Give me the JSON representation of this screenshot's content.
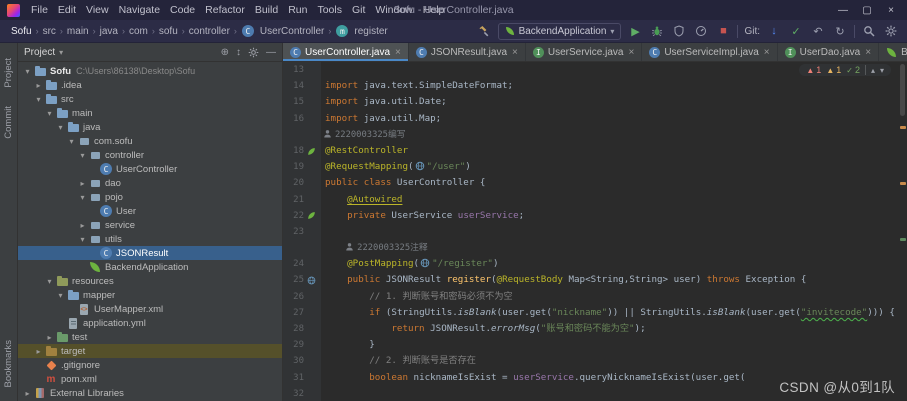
{
  "titlebar": {
    "title": "Sofu - UserController.java",
    "menus": [
      "File",
      "Edit",
      "View",
      "Navigate",
      "Code",
      "Refactor",
      "Build",
      "Run",
      "Tools",
      "Git",
      "Window",
      "Help"
    ],
    "controls": {
      "minimize": "—",
      "maximize": "▢",
      "close": "×"
    }
  },
  "toolbar": {
    "breadcrumbs": [
      {
        "label": "Sofu"
      },
      {
        "label": "src"
      },
      {
        "label": "main"
      },
      {
        "label": "java"
      },
      {
        "label": "com"
      },
      {
        "label": "sofu"
      },
      {
        "label": "controller"
      },
      {
        "label": "UserController",
        "icon": "class"
      },
      {
        "label": "register",
        "icon": "method"
      }
    ],
    "run_config": "BackendApplication",
    "git_label": "Git:"
  },
  "stripe": {
    "top": [
      "Project",
      "Commit"
    ],
    "bottom": [
      "Bookmarks"
    ]
  },
  "project": {
    "header": "Project",
    "tree": [
      {
        "label": "Sofu",
        "sublabel": "C:\\Users\\86138\\Desktop\\Sofu",
        "level": 0,
        "icon": "folder",
        "chevron": "expanded",
        "bold": true
      },
      {
        "label": ".idea",
        "level": 1,
        "icon": "folder",
        "chevron": "collapsed"
      },
      {
        "label": "src",
        "level": 1,
        "icon": "folder",
        "chevron": "expanded"
      },
      {
        "label": "main",
        "level": 2,
        "icon": "folder",
        "chevron": "expanded"
      },
      {
        "label": "java",
        "level": 3,
        "icon": "folder",
        "chevron": "expanded"
      },
      {
        "label": "com.sofu",
        "level": 4,
        "icon": "package",
        "chevron": "expanded"
      },
      {
        "label": "controller",
        "level": 5,
        "icon": "package",
        "chevron": "expanded"
      },
      {
        "label": "UserController",
        "level": 6,
        "icon": "class"
      },
      {
        "label": "dao",
        "level": 5,
        "icon": "package",
        "chevron": "collapsed"
      },
      {
        "label": "pojo",
        "level": 5,
        "icon": "package",
        "chevron": "expanded"
      },
      {
        "label": "User",
        "level": 6,
        "icon": "class"
      },
      {
        "label": "service",
        "level": 5,
        "icon": "package",
        "chevron": "collapsed"
      },
      {
        "label": "utils",
        "level": 5,
        "icon": "package",
        "chevron": "expanded"
      },
      {
        "label": "JSONResult",
        "level": 6,
        "icon": "class",
        "selected": true
      },
      {
        "label": "BackendApplication",
        "level": 5,
        "icon": "spring"
      },
      {
        "label": "resources",
        "level": 2,
        "icon": "folder-res",
        "chevron": "expanded"
      },
      {
        "label": "mapper",
        "level": 3,
        "icon": "folder",
        "chevron": "expanded"
      },
      {
        "label": "UserMapper.xml",
        "level": 4,
        "icon": "xml"
      },
      {
        "label": "application.yml",
        "level": 3,
        "icon": "yml"
      },
      {
        "label": "test",
        "level": 2,
        "icon": "folder-test",
        "chevron": "collapsed"
      },
      {
        "label": "target",
        "level": 1,
        "icon": "folder-exc",
        "chevron": "collapsed",
        "highlight": true
      },
      {
        "label": ".gitignore",
        "level": 1,
        "icon": "git"
      },
      {
        "label": "pom.xml",
        "level": 1,
        "icon": "maven"
      },
      {
        "label": "External Libraries",
        "level": 0,
        "icon": "lib",
        "chevron": "collapsed"
      }
    ]
  },
  "tabs": {
    "close_glyph": "×",
    "items": [
      {
        "label": "UserController.java",
        "icon": "class",
        "active": true
      },
      {
        "label": "JSONResult.java",
        "icon": "class"
      },
      {
        "label": "UserService.java",
        "icon": "interface"
      },
      {
        "label": "UserServiceImpl.java",
        "icon": "class"
      },
      {
        "label": "UserDao.java",
        "icon": "interface"
      },
      {
        "label": "BackendAppl",
        "icon": "spring"
      }
    ]
  },
  "editor": {
    "lines": [
      {
        "num": "13",
        "segs": []
      },
      {
        "num": "14",
        "segs": [
          {
            "s": "kw",
            "t": "import"
          },
          {
            "s": "def",
            "t": " java.text.SimpleDateFormat;"
          }
        ]
      },
      {
        "num": "15",
        "segs": [
          {
            "s": "kw",
            "t": "import"
          },
          {
            "s": "def",
            "t": " java.util.Date;"
          }
        ]
      },
      {
        "num": "16",
        "segs": [
          {
            "s": "kw",
            "t": "import"
          },
          {
            "s": "def",
            "t": " java.util.Map;"
          }
        ]
      },
      {
        "hint": "2220003325编写",
        "indent": 0
      },
      {
        "num": "18",
        "gutter": "spring",
        "segs": [
          {
            "s": "ann",
            "t": "@RestController"
          }
        ]
      },
      {
        "num": "19",
        "segs": [
          {
            "s": "ann",
            "t": "@RequestMapping"
          },
          {
            "s": "def",
            "t": "("
          },
          {
            "s": "globe",
            "t": ""
          },
          {
            "s": "str",
            "t": "\"/user\""
          },
          {
            "s": "def",
            "t": ")"
          }
        ]
      },
      {
        "num": "20",
        "segs": [
          {
            "s": "kw",
            "t": "public class"
          },
          {
            "s": "def",
            "t": " UserController {"
          }
        ]
      },
      {
        "num": "21",
        "segs": [
          {
            "s": "def",
            "t": "    "
          },
          {
            "s": "annul",
            "t": "@Autowired"
          }
        ]
      },
      {
        "num": "22",
        "gutter": "spring",
        "segs": [
          {
            "s": "def",
            "t": "    "
          },
          {
            "s": "kw",
            "t": "private"
          },
          {
            "s": "def",
            "t": " UserService "
          },
          {
            "s": "field",
            "t": "userService"
          },
          {
            "s": "def",
            "t": ";"
          }
        ]
      },
      {
        "num": "23",
        "segs": []
      },
      {
        "hint": "2220003325注释",
        "indent": 4
      },
      {
        "num": "24",
        "segs": [
          {
            "s": "def",
            "t": "    "
          },
          {
            "s": "ann",
            "t": "@PostMapping"
          },
          {
            "s": "def",
            "t": "("
          },
          {
            "s": "globe",
            "t": ""
          },
          {
            "s": "str",
            "t": "\"/register\""
          },
          {
            "s": "def",
            "t": ")"
          }
        ]
      },
      {
        "num": "25",
        "gutter": "endpoint",
        "segs": [
          {
            "s": "def",
            "t": "    "
          },
          {
            "s": "kw",
            "t": "public"
          },
          {
            "s": "def",
            "t": " JSONResult "
          },
          {
            "s": "method",
            "t": "register"
          },
          {
            "s": "def",
            "t": "("
          },
          {
            "s": "ann",
            "t": "@RequestBody"
          },
          {
            "s": "def",
            "t": " Map<String,String> user) "
          },
          {
            "s": "kw",
            "t": "throws"
          },
          {
            "s": "def",
            "t": " Exception {"
          }
        ]
      },
      {
        "num": "26",
        "segs": [
          {
            "s": "cmt",
            "t": "        // 1. 判断账号和密码必须不为空"
          }
        ]
      },
      {
        "num": "27",
        "segs": [
          {
            "s": "def",
            "t": "        "
          },
          {
            "s": "kw",
            "t": "if"
          },
          {
            "s": "def",
            "t": " (StringUtils."
          },
          {
            "s": "smi",
            "t": "isBlank"
          },
          {
            "s": "def",
            "t": "(user.get("
          },
          {
            "s": "str",
            "t": "\"nickname\""
          },
          {
            "s": "def",
            "t": ")) || StringUtils."
          },
          {
            "s": "smi",
            "t": "isBlank"
          },
          {
            "s": "def",
            "t": "(user.get("
          },
          {
            "s": "strul",
            "t": "\"invitecode\""
          },
          {
            "s": "def",
            "t": "))) {"
          }
        ]
      },
      {
        "num": "28",
        "segs": [
          {
            "s": "def",
            "t": "            "
          },
          {
            "s": "kw",
            "t": "return"
          },
          {
            "s": "def",
            "t": " JSONResult."
          },
          {
            "s": "smi",
            "t": "errorMsg"
          },
          {
            "s": "def",
            "t": "("
          },
          {
            "s": "str",
            "t": "\"账号和密码不能为空\""
          },
          {
            "s": "def",
            "t": ");"
          }
        ]
      },
      {
        "num": "29",
        "segs": [
          {
            "s": "def",
            "t": "        }"
          }
        ]
      },
      {
        "num": "30",
        "segs": [
          {
            "s": "cmt",
            "t": "        // 2. 判断账号是否存在"
          }
        ]
      },
      {
        "num": "31",
        "segs": [
          {
            "s": "def",
            "t": "        "
          },
          {
            "s": "kw",
            "t": "boolean"
          },
          {
            "s": "def",
            "t": " nicknameIsExist = "
          },
          {
            "s": "field",
            "t": "userService"
          },
          {
            "s": "def",
            "t": ".queryNicknameIsExist(user.get("
          }
        ]
      },
      {
        "num": "32",
        "segs": []
      }
    ]
  },
  "inspections": {
    "items": [
      {
        "kind": "error",
        "glyph": "▲",
        "count": "1"
      },
      {
        "kind": "warning",
        "glyph": "▲",
        "count": "1"
      },
      {
        "kind": "ok",
        "glyph": "✓",
        "count": "2"
      }
    ]
  },
  "watermark": "CSDN @从0到1队"
}
